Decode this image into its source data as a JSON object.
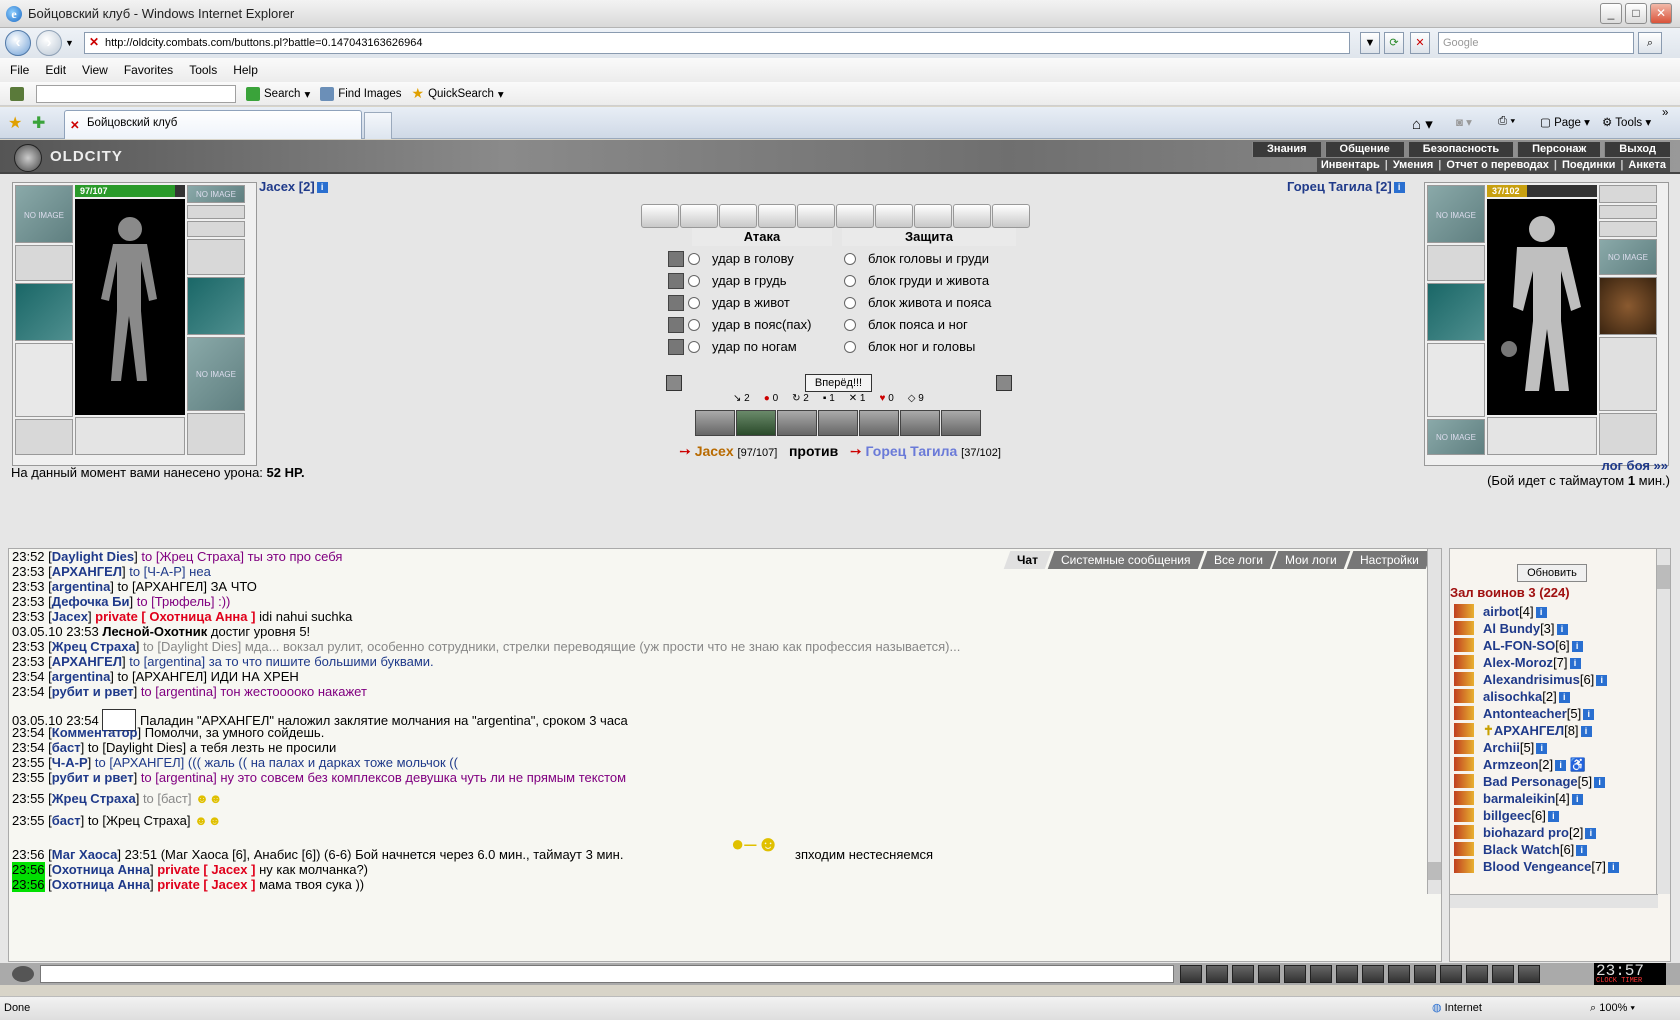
{
  "window": {
    "title": "Бойцовский клуб - Windows Internet Explorer",
    "min": "_",
    "max": "□",
    "close": "✕"
  },
  "address": {
    "url": "http://oldcity.combats.com/buttons.pl?battle=0.147043163626964",
    "search_placeholder": "Google"
  },
  "menu": {
    "file": "File",
    "edit": "Edit",
    "view": "View",
    "favorites": "Favorites",
    "tools": "Tools",
    "help": "Help"
  },
  "toolbar": {
    "search": "Search",
    "find_images": "Find Images",
    "quicksearch": "QuickSearch"
  },
  "tab": {
    "title": "Бойцовский клуб",
    "page": "Page",
    "tools": "Tools"
  },
  "site": {
    "logo": "OLDCITY",
    "nav_main": [
      "Знания",
      "Общение",
      "Безопасность",
      "Персонаж",
      "Выход"
    ],
    "nav_sub": [
      "Инвентарь",
      "Умения",
      "Отчет о переводах",
      "Поединки",
      "Анкета"
    ]
  },
  "player": {
    "name": "Jacex [2]",
    "hp_text": "97/107",
    "hp": 0.906,
    "no_image": "NO IMAGE"
  },
  "opponent": {
    "name": "Горец Тагила [2]",
    "hp_text": "37/102",
    "hp": 0.363,
    "no_image": "NO IMAGE"
  },
  "battle": {
    "attack_title": "Атака",
    "defense_title": "Защита",
    "attacks": [
      "удар в голову",
      "удар в грудь",
      "удар в живот",
      "удар в пояс(пах)",
      "удар по ногам"
    ],
    "blocks": [
      "блок головы и груди",
      "блок груди и живота",
      "блок живота и пояса",
      "блок пояса и ног",
      "блок ног и головы"
    ],
    "go_button": "Вперёд!!!",
    "stats": [
      "2",
      "0",
      "2",
      "1",
      "1",
      "0",
      "9"
    ],
    "vs_player": "Jacex",
    "vs_player_hp": "[97/107]",
    "vs_word": "против",
    "vs_opponent": "Горец Тагила",
    "vs_opponent_hp": "[37/102]",
    "damage_prefix": "На данный момент вами нанесено урона:",
    "damage_value": "52 HP.",
    "log_link": "лог боя »»",
    "timeout_prefix": "(Бой идет с таймаутом",
    "timeout_value": "1",
    "timeout_suffix": "мин.)"
  },
  "chat_tabs": [
    "Чат",
    "Системные сообщения",
    "Все логи",
    "Мои логи",
    "Настройки"
  ],
  "chat": [
    {
      "time": "23:52",
      "from": "Daylight Dies",
      "to": "to [Жрец Страха]",
      "text": "ты это про себя"
    },
    {
      "time": "23:53",
      "from": "АРХАНГЕЛ",
      "to": "to [Ч-А-Р]",
      "text": "неа"
    },
    {
      "time": "23:53",
      "from": "argentina",
      "to": "to [АРХАНГЕЛ]",
      "text": "ЗА ЧТО"
    },
    {
      "time": "23:53",
      "from": "Дефочка Би",
      "to": "to [Трюфель]",
      "text": ":))"
    },
    {
      "time": "23:53",
      "from": "Jacex",
      "to": "private [ Охотница Анна ]",
      "text": "idi nahui suchka"
    },
    {
      "time": "03.05.10 23:53",
      "from": "Лесной-Охотник",
      "to": "",
      "text": "достиг уровня 5!"
    },
    {
      "time": "23:53",
      "from": "Жрец Страха",
      "to": "to [Daylight Dies]",
      "text": "мда... вокзал рулит, особенно сотрудники, стрелки переводящие (уж прости что не знаю как профессия называется)..."
    },
    {
      "time": "23:53",
      "from": "АРХАНГЕЛ",
      "to": "to [argentina]",
      "text": "за то что пишите большими буквами."
    },
    {
      "time": "23:54",
      "from": "argentina",
      "to": "to [АРХАНГЕЛ]",
      "text": "ИДИ НА ХРЕН"
    },
    {
      "time": "23:54",
      "from": "рубит и рвет",
      "to": "to [argentina]",
      "text": "тон жестоооокo накажет"
    },
    {
      "time": "03.05.10 23:54",
      "from": "",
      "to": "",
      "text": "Паладин \"АРХАНГЕЛ\" наложил заклятие молчания на \"argentina\", сроком 3 часа"
    },
    {
      "time": "23:54",
      "from": "Комментатор",
      "to": "",
      "text": "Помолчи, за умного сойдешь."
    },
    {
      "time": "23:54",
      "from": "баст",
      "to": "to [Daylight Dies]",
      "text": "а тебя лезть не просили"
    },
    {
      "time": "23:55",
      "from": "Ч-А-Р",
      "to": "to [АРХАНГЕЛ]",
      "text": "((( жаль (( на палах и дарках тоже мольчок (("
    },
    {
      "time": "23:55",
      "from": "рубит и рвет",
      "to": "to [argentina]",
      "text": "ну это совсем без комплексов девушка чуть ли не прямым текстом"
    },
    {
      "time": "23:55",
      "from": "Жрец Страха",
      "to": "to [баст]",
      "text": ""
    },
    {
      "time": "23:55",
      "from": "баст",
      "to": "to [Жрец Страха]",
      "text": ""
    },
    {
      "time": "23:56",
      "from": "Маг Хаоса",
      "to": "",
      "text": "23:51 (Маг Хаоса [6], Анабис [6]) (6-6) Бой начнется через 6.0 мин., таймаут 3 мин."
    },
    {
      "time": "23:56",
      "from": "Охотница Анна",
      "to": "private [ Jacex ]",
      "text": "ну как молчанка?)"
    },
    {
      "time": "23:56",
      "from": "Охотница Анна",
      "to": "private [ Jacex ]",
      "text": "мама твоя сука ))"
    }
  ],
  "chat_extra": "зпходим нестесняемся",
  "users": {
    "refresh": "Обновить",
    "room": "Зал воинов 3 (224)",
    "list": [
      {
        "name": "airbot",
        "lvl": "[4]"
      },
      {
        "name": "Al Bundy",
        "lvl": "[3]"
      },
      {
        "name": "AL-FON-SO",
        "lvl": "[6]"
      },
      {
        "name": "Alex-Moroz",
        "lvl": "[7]"
      },
      {
        "name": "Alexandrisimus",
        "lvl": "[6]"
      },
      {
        "name": "alisochka",
        "lvl": "[2]"
      },
      {
        "name": "Antonteacher",
        "lvl": "[5]"
      },
      {
        "name": "АРХАНГЕЛ",
        "lvl": "[8]"
      },
      {
        "name": "Archii",
        "lvl": "[5]"
      },
      {
        "name": "Armzeon",
        "lvl": "[2]"
      },
      {
        "name": "Bad Personage",
        "lvl": "[5]"
      },
      {
        "name": "barmaleikin",
        "lvl": "[4]"
      },
      {
        "name": "billgeec",
        "lvl": "[6]"
      },
      {
        "name": "biohazard pro",
        "lvl": "[2]"
      },
      {
        "name": "Black Watch",
        "lvl": "[6]"
      },
      {
        "name": "Blood Vengeance",
        "lvl": "[7]"
      }
    ]
  },
  "clock": {
    "time": "23:57",
    "label": "CLOCK TIMER"
  },
  "status": {
    "left": "Done",
    "zone": "Internet",
    "zoom": "100%"
  }
}
